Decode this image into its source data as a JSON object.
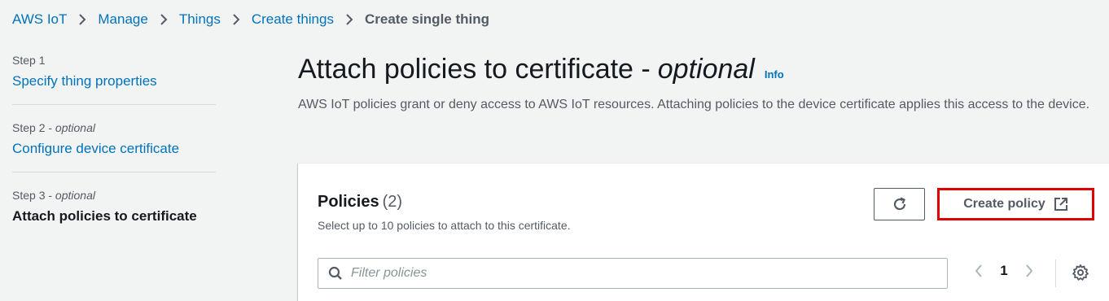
{
  "breadcrumb": {
    "items": [
      "AWS IoT",
      "Manage",
      "Things",
      "Create things"
    ],
    "current": "Create single thing"
  },
  "steps": [
    {
      "label": "Step 1",
      "optional": "",
      "title": "Specify thing properties"
    },
    {
      "label": "Step 2 - ",
      "optional": "optional",
      "title": "Configure device certificate"
    },
    {
      "label": "Step 3 - ",
      "optional": "optional",
      "title": "Attach policies to certificate"
    }
  ],
  "page": {
    "title": "Attach policies to certificate -",
    "title_optional": "optional",
    "info": "Info",
    "description": "AWS IoT policies grant or deny access to AWS IoT resources. Attaching policies to the device certificate applies this access to the device."
  },
  "policies": {
    "title": "Policies",
    "count": "(2)",
    "subtitle": "Select up to 10 policies to attach to this certificate.",
    "create_label": "Create policy",
    "filter_placeholder": "Filter policies",
    "current_page": "1"
  },
  "colors": {
    "link": "#0073bb",
    "highlight": "#e00000"
  }
}
